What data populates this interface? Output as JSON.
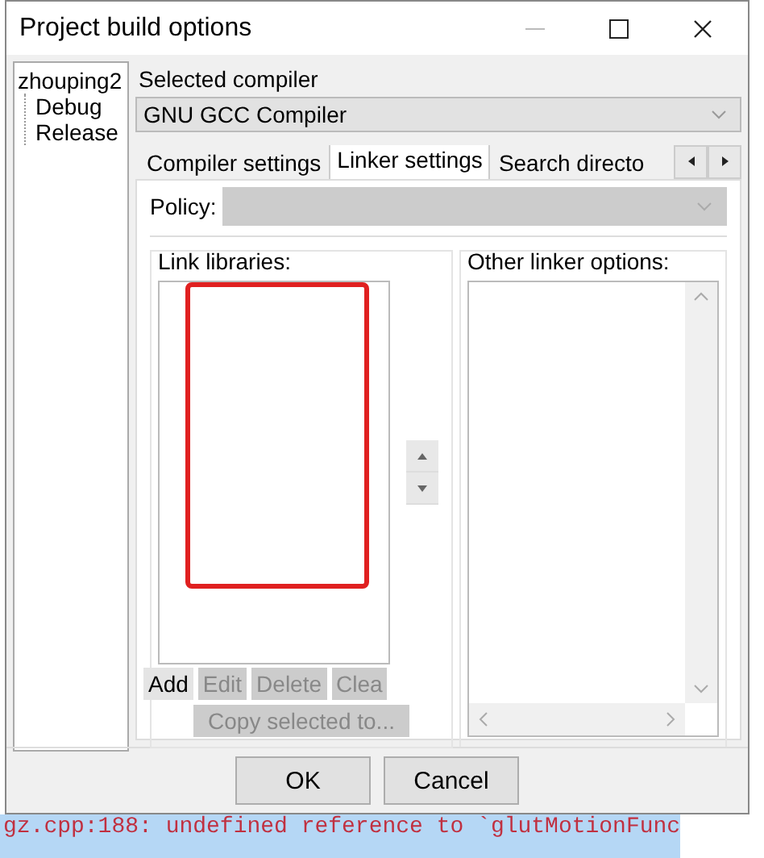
{
  "window": {
    "title": "Project build options"
  },
  "tree": [
    {
      "label": "zhouping2",
      "selected": false,
      "children": [
        {
          "label": "Debug",
          "selected": false
        },
        {
          "label": "Release",
          "selected": false
        }
      ]
    }
  ],
  "compiler": {
    "label": "Selected compiler",
    "value": "GNU GCC Compiler"
  },
  "tabs": [
    {
      "label": "Compiler settings",
      "selected": false
    },
    {
      "label": "Linker settings",
      "selected": true
    },
    {
      "label": "Search directo",
      "selected": false
    }
  ],
  "policy": {
    "label": "Policy:",
    "disabled": true
  },
  "link_libraries": {
    "label": "Link libraries:",
    "buttons": [
      {
        "label": "Add",
        "disabled": false
      },
      {
        "label": "Edit",
        "disabled": true
      },
      {
        "label": "Delete",
        "disabled": true
      },
      {
        "label": "Clea",
        "disabled": true
      }
    ],
    "copy_button": {
      "label": "Copy selected to...",
      "disabled": true
    }
  },
  "other_linker_options": {
    "label": "Other linker options:"
  },
  "buttons": [
    {
      "label": "OK"
    },
    {
      "label": "Cancel"
    }
  ],
  "background_log": {
    "text": "gz.cpp:188: undefined reference to `glutMotionFunc"
  }
}
